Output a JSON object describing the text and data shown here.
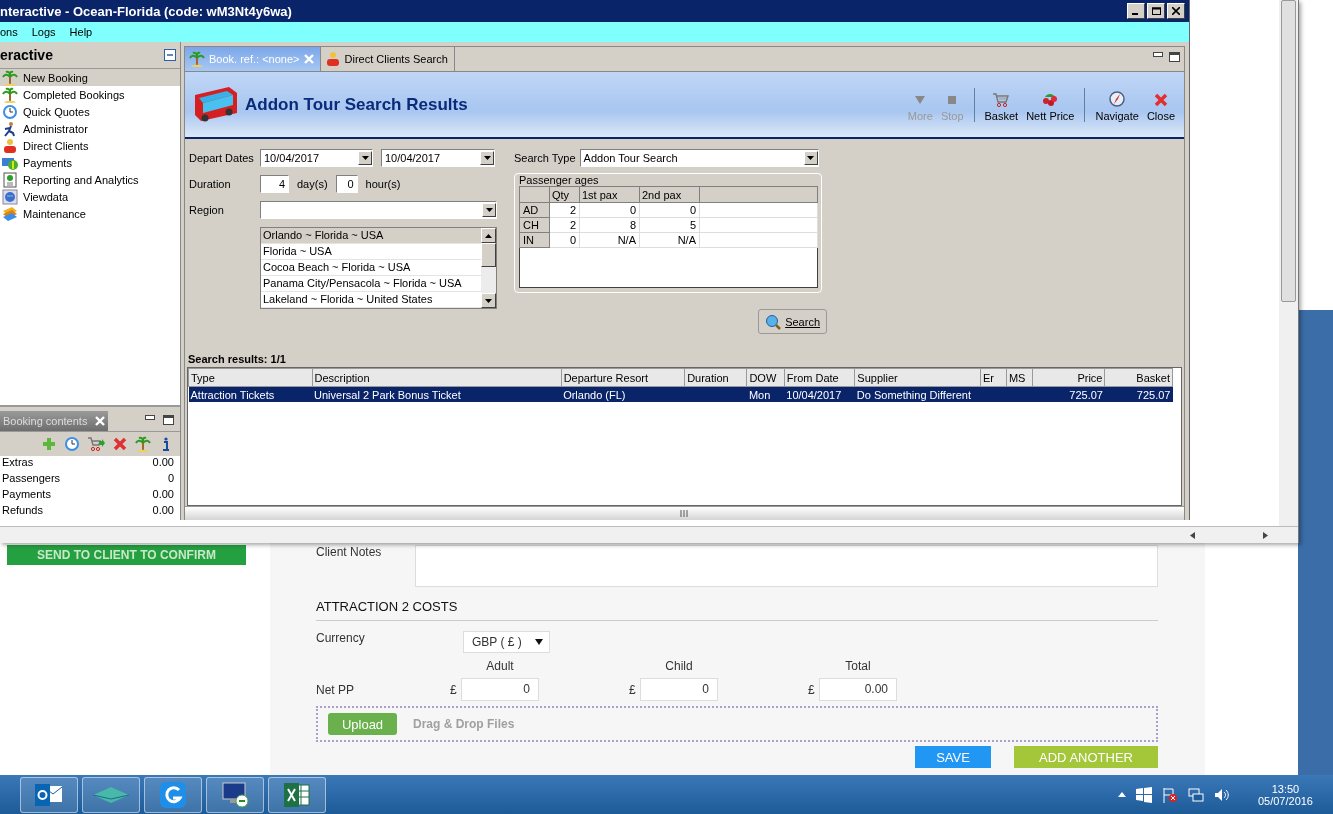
{
  "app": {
    "title": "nteractive - Ocean-Florida (code: wM3Nt4y6wa)",
    "menu": [
      "ons",
      "Logs",
      "Help"
    ],
    "nav": {
      "title": "eractive",
      "items": [
        {
          "label": "New Booking",
          "selected": true
        },
        {
          "label": "Completed Bookings",
          "selected": false
        },
        {
          "label": "Quick Quotes",
          "selected": false
        },
        {
          "label": "Administrator",
          "selected": false
        },
        {
          "label": "Direct Clients",
          "selected": false
        },
        {
          "label": "Payments",
          "selected": false
        },
        {
          "label": "Reporting and Analytics",
          "selected": false
        },
        {
          "label": "Viewdata",
          "selected": false
        },
        {
          "label": "Maintenance",
          "selected": false
        }
      ]
    },
    "booking_contents": {
      "tab": "Booking contents",
      "rows": [
        {
          "label": "Extras",
          "value": "0.00"
        },
        {
          "label": "Passengers",
          "value": "0"
        },
        {
          "label": "Payments",
          "value": "0.00"
        },
        {
          "label": "Refunds",
          "value": "0.00"
        }
      ]
    },
    "tabs": [
      {
        "label": "Book. ref.: <none>",
        "selected": true
      },
      {
        "label": "Direct Clients Search",
        "selected": false
      }
    ],
    "header": {
      "title": "Addon Tour Search Results"
    },
    "toolbar": [
      {
        "label": "More",
        "disabled": true
      },
      {
        "label": "Stop",
        "disabled": true
      },
      {
        "label": "Basket",
        "disabled": false
      },
      {
        "label": "Nett Price",
        "disabled": false
      },
      {
        "label": "Navigate",
        "disabled": false
      },
      {
        "label": "Close",
        "disabled": false
      }
    ],
    "form": {
      "depart_label": "Depart Dates",
      "depart_from": "10/04/2017",
      "depart_to": "10/04/2017",
      "duration_label": "Duration",
      "days": "4",
      "days_unit": "day(s)",
      "hours": "0",
      "hours_unit": "hour(s)",
      "region_label": "Region",
      "regions": [
        {
          "label": "Orlando ~ Florida ~ USA",
          "selected": true
        },
        {
          "label": "Florida ~ USA",
          "selected": false
        },
        {
          "label": "Cocoa Beach ~ Florida ~ USA",
          "selected": false
        },
        {
          "label": "Panama City/Pensacola ~  Florida  ~ USA",
          "selected": false
        },
        {
          "label": "Lakeland ~ Florida ~ United States",
          "selected": false
        }
      ],
      "search_type_label": "Search Type",
      "search_type": "Addon Tour Search",
      "passenger_ages": {
        "title": "Passenger ages",
        "columns": [
          "Qty",
          "1st pax",
          "2nd pax"
        ],
        "rows": [
          {
            "label": "AD",
            "values": [
              "2",
              "0",
              "0"
            ]
          },
          {
            "label": "CH",
            "values": [
              "2",
              "8",
              "5"
            ]
          },
          {
            "label": "IN",
            "values": [
              "0",
              "N/A",
              "N/A"
            ]
          }
        ]
      },
      "search_button": "Search"
    },
    "results": {
      "label": "Search results: 1/1",
      "columns": [
        "Type",
        "Description",
        "Departure Resort",
        "Duration",
        "DOW",
        "From Date",
        "Supplier",
        "Er",
        "MS",
        "Price",
        "Basket"
      ],
      "rows": [
        {
          "selected": true,
          "cells": [
            "Attraction Tickets",
            "Universal 2 Park Bonus Ticket",
            "Orlando (FL)",
            "",
            "Mon",
            "10/04/2017",
            "Do Something Different",
            "",
            "",
            "725.07",
            "725.07"
          ]
        }
      ]
    }
  },
  "web": {
    "send_button": "SEND TO CLIENT TO CONFIRM",
    "client_notes_label": "Client Notes",
    "section_title": "ATTRACTION 2 COSTS",
    "currency_label": "Currency",
    "currency": "GBP ( £ )",
    "net_pp_label": "Net PP",
    "price_fields": [
      {
        "label": "Adult",
        "symbol": "£",
        "value": "0"
      },
      {
        "label": "Child",
        "symbol": "£",
        "value": "0"
      },
      {
        "label": "Total",
        "symbol": "£",
        "value": "0.00"
      }
    ],
    "upload_button": "Upload",
    "drop_hint": "Drag & Drop Files",
    "save_button": "SAVE",
    "add_button": "ADD ANOTHER"
  },
  "taskbar": {
    "time": "13:50",
    "date": "05/07/2016"
  }
}
